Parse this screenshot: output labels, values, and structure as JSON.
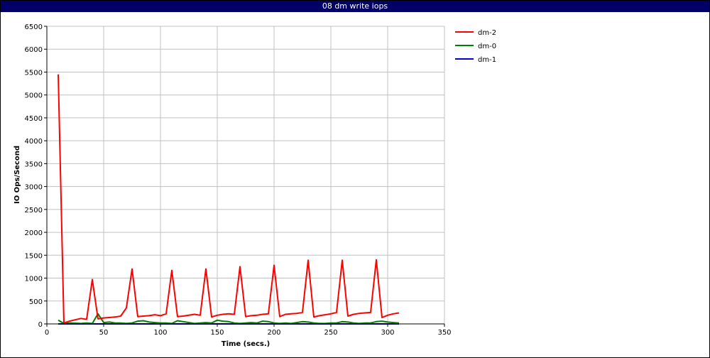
{
  "chart_data": {
    "type": "line",
    "title": "08 dm write iops",
    "xlabel": "Time (secs.)",
    "ylabel": "IO Ops/Second",
    "xlim": [
      0,
      350
    ],
    "ylim": [
      0,
      6500
    ],
    "xticks": [
      0,
      50,
      100,
      150,
      200,
      250,
      300,
      350
    ],
    "yticks": [
      0,
      500,
      1000,
      1500,
      2000,
      2500,
      3000,
      3500,
      4000,
      4500,
      5000,
      5500,
      6000,
      6500
    ],
    "grid": true,
    "legend_position": "top-right",
    "series": [
      {
        "name": "dm-2",
        "color": "#ff0000",
        "x": [
          10,
          15,
          20,
          25,
          30,
          35,
          40,
          45,
          50,
          55,
          60,
          65,
          70,
          75,
          80,
          85,
          90,
          95,
          100,
          105,
          110,
          115,
          120,
          125,
          130,
          135,
          140,
          145,
          150,
          155,
          160,
          165,
          170,
          175,
          180,
          185,
          190,
          195,
          200,
          205,
          210,
          215,
          220,
          225,
          230,
          235,
          240,
          245,
          250,
          255,
          260,
          265,
          270,
          275,
          280,
          285,
          290,
          295,
          300,
          305,
          310
        ],
        "values": [
          5450,
          20,
          60,
          90,
          120,
          100,
          970,
          110,
          130,
          140,
          150,
          170,
          350,
          1200,
          160,
          170,
          180,
          200,
          180,
          220,
          1170,
          160,
          170,
          190,
          210,
          190,
          1200,
          150,
          190,
          210,
          220,
          210,
          1250,
          160,
          180,
          190,
          210,
          220,
          1280,
          160,
          210,
          220,
          230,
          250,
          1390,
          150,
          180,
          200,
          220,
          250,
          1390,
          170,
          210,
          230,
          240,
          250,
          1400,
          140,
          190,
          220,
          240
        ]
      },
      {
        "name": "dm-0",
        "color": "#008000",
        "x": [
          10,
          15,
          20,
          25,
          30,
          35,
          40,
          45,
          50,
          55,
          60,
          65,
          70,
          75,
          80,
          85,
          90,
          95,
          100,
          105,
          110,
          115,
          120,
          125,
          130,
          135,
          140,
          145,
          150,
          155,
          160,
          165,
          170,
          175,
          180,
          185,
          190,
          195,
          200,
          205,
          210,
          215,
          220,
          225,
          230,
          235,
          240,
          245,
          250,
          255,
          260,
          265,
          270,
          275,
          280,
          285,
          290,
          295,
          300,
          305,
          310
        ],
        "values": [
          80,
          10,
          20,
          15,
          10,
          20,
          10,
          220,
          30,
          40,
          20,
          20,
          10,
          20,
          60,
          70,
          40,
          30,
          20,
          20,
          10,
          70,
          50,
          30,
          10,
          20,
          30,
          20,
          80,
          60,
          50,
          20,
          10,
          20,
          30,
          20,
          60,
          50,
          20,
          10,
          20,
          10,
          30,
          50,
          40,
          20,
          10,
          10,
          20,
          20,
          50,
          40,
          20,
          10,
          20,
          20,
          50,
          60,
          40,
          30,
          20
        ]
      },
      {
        "name": "dm-1",
        "color": "#0000cc",
        "x": [
          10,
          15,
          20,
          25,
          30,
          35,
          40,
          45,
          50,
          55,
          60,
          65,
          70,
          75,
          80,
          85,
          90,
          95,
          100,
          105,
          110,
          115,
          120,
          125,
          130,
          135,
          140,
          145,
          150,
          155,
          160,
          165,
          170,
          175,
          180,
          185,
          190,
          195,
          200,
          205,
          210,
          215,
          220,
          225,
          230,
          235,
          240,
          245,
          250,
          255,
          260,
          265,
          270,
          275,
          280,
          285,
          290,
          295,
          300,
          305,
          310
        ],
        "values": [
          0,
          0,
          0,
          0,
          0,
          0,
          0,
          0,
          0,
          0,
          0,
          0,
          0,
          0,
          0,
          0,
          0,
          0,
          0,
          0,
          0,
          0,
          0,
          0,
          0,
          0,
          0,
          0,
          0,
          0,
          0,
          0,
          0,
          0,
          0,
          0,
          0,
          0,
          0,
          0,
          0,
          0,
          0,
          0,
          0,
          0,
          0,
          0,
          0,
          0,
          0,
          0,
          0,
          0,
          0,
          0,
          0,
          0,
          0,
          0,
          0
        ]
      }
    ]
  }
}
